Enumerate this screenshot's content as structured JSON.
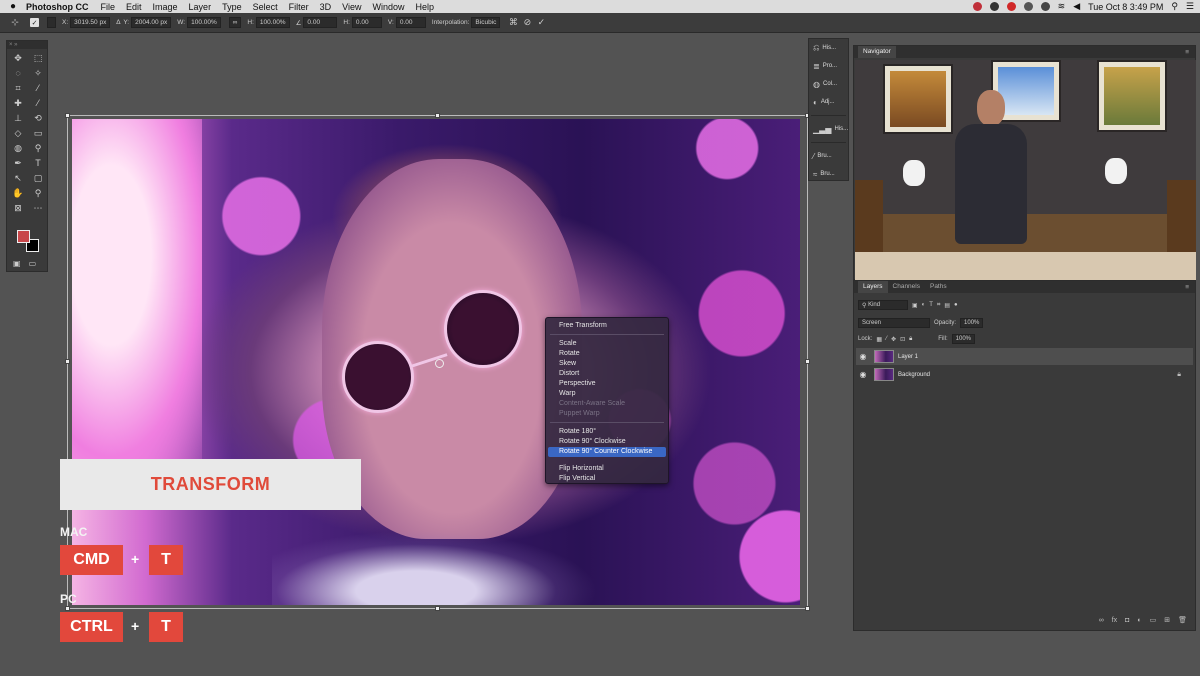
{
  "menubar": {
    "app_name": "Photoshop CC",
    "menus": [
      "File",
      "Edit",
      "Image",
      "Layer",
      "Type",
      "Select",
      "Filter",
      "3D",
      "View",
      "Window",
      "Help"
    ],
    "clock": "Tue Oct 8  3:49 PM"
  },
  "options_bar": {
    "x_label": "X:",
    "x_value": "3019.50 px",
    "y_label": "Y:",
    "y_value": "2004.00 px",
    "w_label": "W:",
    "w_value": "100.00%",
    "h_label": "H:",
    "h_value": "100.00%",
    "angle_value": "0.00",
    "hskew_label": "H:",
    "hskew_value": "0.00",
    "vskew_label": "V:",
    "vskew_value": "0.00",
    "interp_label": "Interpolation:",
    "interp_value": "Bicubic"
  },
  "tools": {
    "items": [
      "move-tool-icon",
      "marquee-tool-icon",
      "lasso-tool-icon",
      "magic-wand-icon",
      "crop-tool-icon",
      "eyedropper-icon",
      "healing-brush-icon",
      "brush-tool-icon",
      "stamp-tool-icon",
      "history-brush-icon",
      "eraser-icon",
      "gradient-tool-icon",
      "blur-tool-icon",
      "dodge-tool-icon",
      "pen-tool-icon",
      "type-tool-icon",
      "path-select-icon",
      "shape-tool-icon",
      "hand-tool-icon",
      "zoom-tool-icon",
      "edit-toolbar-icon",
      "more-tools-icon"
    ],
    "glyphs": [
      "✥",
      "⬚",
      "◌",
      "✧",
      "⌗",
      "⁄",
      "✚",
      "⁄",
      "⊥",
      "⟲",
      "◇",
      "▭",
      "◍",
      "⚲",
      "✒",
      "T",
      "↖",
      "▢",
      "✋",
      "⚲",
      "⊠",
      "⋯"
    ],
    "foreground_color": "#c8474a",
    "background_color": "#000000"
  },
  "context_menu": {
    "free_transform": "Free Transform",
    "group1": [
      "Scale",
      "Rotate",
      "Skew",
      "Distort",
      "Perspective",
      "Warp"
    ],
    "disabled": [
      "Content-Aware Scale",
      "Puppet Warp"
    ],
    "group2": [
      "Rotate 180°",
      "Rotate 90° Clockwise"
    ],
    "selected": "Rotate 90° Counter Clockwise",
    "group3": [
      "Flip Horizontal",
      "Flip Vertical"
    ]
  },
  "overlay": {
    "title": "TRANSFORM",
    "mac_label": "MAC",
    "mac_keys": [
      "CMD",
      "T"
    ],
    "pc_label": "PC",
    "pc_keys": [
      "CTRL",
      "T"
    ],
    "plus": "+",
    "accent": "#e2483c"
  },
  "panel_strip": {
    "items": [
      {
        "icon": "history-icon",
        "label": "His..."
      },
      {
        "icon": "properties-icon",
        "label": "Pro..."
      },
      {
        "icon": "color-icon",
        "label": "Col..."
      },
      {
        "icon": "adjustments-icon",
        "label": "Adj..."
      },
      {
        "icon": "histogram-icon",
        "label": "His..."
      },
      {
        "icon": "brush-icon",
        "label": "Bru..."
      },
      {
        "icon": "brush-settings-icon",
        "label": "Bru..."
      }
    ]
  },
  "navigator": {
    "tab": "Navigator"
  },
  "layers_panel": {
    "tabs": [
      "Layers",
      "Channels",
      "Paths"
    ],
    "filter_kind": "Kind",
    "blend_mode": "Screen",
    "opacity_label": "Opacity:",
    "opacity_value": "100%",
    "lock_label": "Lock:",
    "fill_label": "Fill:",
    "fill_value": "100%",
    "layers": [
      {
        "name": "Layer 1",
        "selected": true
      },
      {
        "name": "Background",
        "selected": false,
        "locked": true
      }
    ]
  }
}
